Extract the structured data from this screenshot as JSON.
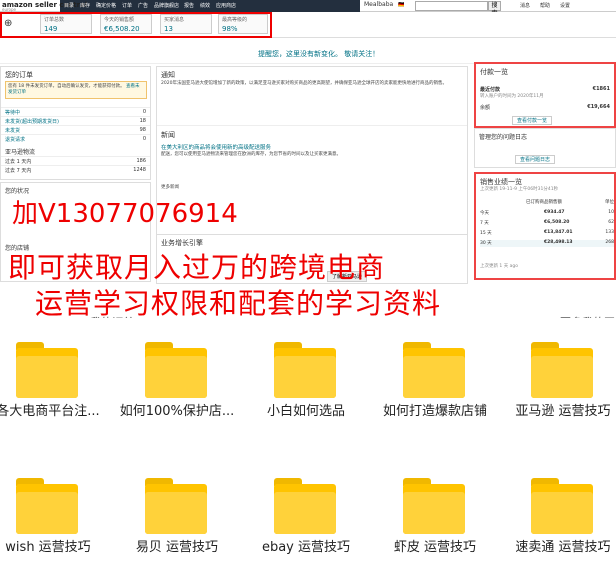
{
  "topbar": {
    "logo": "amazon seller central",
    "logo_sub": "europe",
    "nav": [
      "目录",
      "库存",
      "确定价格",
      "订单",
      "广告",
      "品牌旗舰店",
      "报告",
      "绩效",
      "应用商店"
    ],
    "store": "Mealbaba",
    "marketplace": "www.amazon.de",
    "search_btn": "搜索",
    "links": [
      "消息",
      "帮助",
      "设置"
    ]
  },
  "metrics": [
    {
      "label": "订单总数",
      "value": "149"
    },
    {
      "label": "今天的销售额",
      "value": "€6,508.20"
    },
    {
      "label": "买家消息",
      "value": "13"
    },
    {
      "label": "最高等级的",
      "value": "98%"
    }
  ],
  "banner": "提醒您，这里没有新变化。   敬请关注！",
  "orders": {
    "title": "您的订单",
    "alert": "您有 18 件未发货订单，自动后确认发货，才能获得付款。",
    "alert_link": "查看未发货订单",
    "rows": [
      {
        "label": "等待中",
        "value": "0"
      },
      {
        "label": "未发货(超出预期发货日)",
        "value": "18"
      },
      {
        "label": "未发货",
        "value": "98"
      },
      {
        "label": "退货请求",
        "value": "0"
      }
    ],
    "section2": "亚马逊物流",
    "rows2": [
      {
        "label": "过去 1 天内",
        "value": "186"
      },
      {
        "label": "过去 7 天内",
        "value": "1248"
      }
    ],
    "section3": "您的状况",
    "section4": "您的店铺"
  },
  "notice": {
    "title": "通知",
    "body": "2020年法国亚马逊大使馆增加了新的政策，以满足亚马逊买家对购买商品的更高期望，并确保亚马逊全球开店的卖家能更快地进行商品的销售。",
    "news_title": "新闻",
    "news_link": "在美大利区的商品将会使用新的高级配送服务",
    "news_body": "配送，您可以使用亚马逊物流来管理您在欧洲的库存，为您节省的时间以及让买家更满意。",
    "more": "更多新闻",
    "growth_title": "业务增长引擎",
    "growth_btn": "了解新亚马逊"
  },
  "payment": {
    "title": "付款一览",
    "latest_label": "最近付款",
    "latest_value": "€1861",
    "note": "转入账户的时间为 2020年11月",
    "balance_label": "余额",
    "balance_value": "€19,664",
    "link": "查看付款一览"
  },
  "performance": {
    "title": "管理您的问题日志",
    "link": "查看问题日志"
  },
  "sales": {
    "title": "销售业绩一览",
    "subtitle": "上次更新 19-11-9 上午06时31分41秒",
    "col1": "已订购商品销售额",
    "col2": "单位",
    "rows": [
      {
        "label": "今天",
        "value": "€934.47",
        "units": "10"
      },
      {
        "label": "7 天",
        "value": "€6,508.20",
        "units": "62"
      },
      {
        "label": "15 天",
        "value": "€13,847.01",
        "units": "133"
      },
      {
        "label": "30 天",
        "value": "€28,498.13",
        "units": "268"
      }
    ],
    "footer": "上次更新 1 天 ago"
  },
  "overlay": {
    "line1": "加V13077076914",
    "line2": "即可获取月入过万的跨境电商",
    "line3": "运营学习权限和配套的学习资料"
  },
  "partial_bar": {
    "left": "我的订单",
    "right": "更多我的网"
  },
  "folders": [
    {
      "name": "各大电商平台注..."
    },
    {
      "name": "如何100%保护店..."
    },
    {
      "name": "小白如何选品"
    },
    {
      "name": "如何打造爆款店铺"
    },
    {
      "name": "亚马逊 运营技巧"
    },
    {
      "name": "wish 运营技巧"
    },
    {
      "name": "易贝 运营技巧"
    },
    {
      "name": "ebay 运营技巧"
    },
    {
      "name": "虾皮 运营技巧"
    },
    {
      "name": "速卖通 运营技巧"
    }
  ]
}
